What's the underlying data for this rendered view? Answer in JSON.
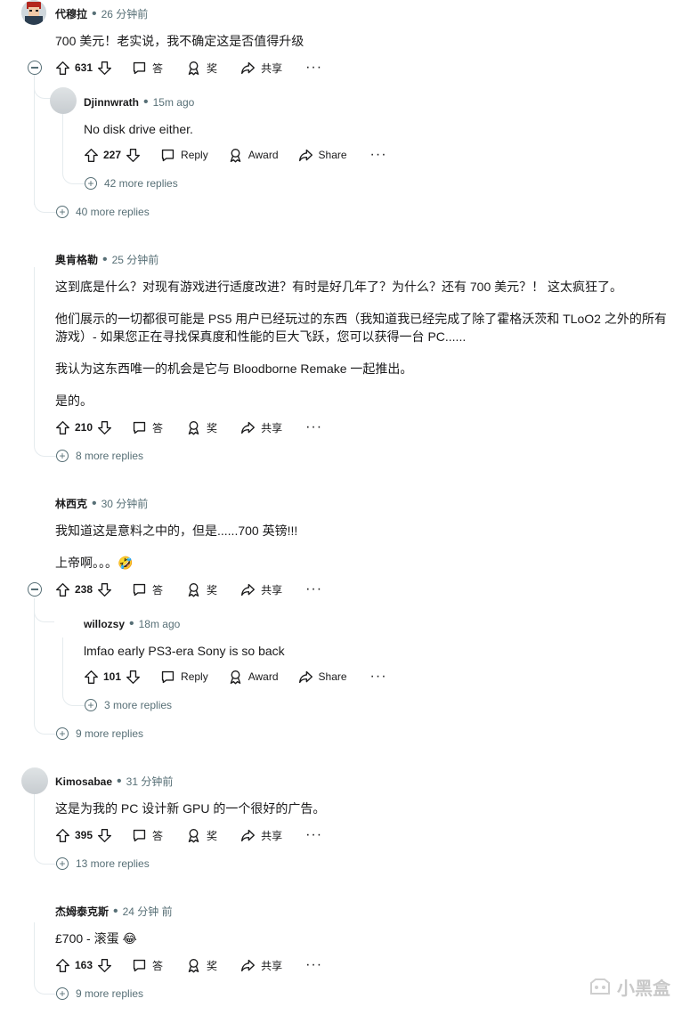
{
  "comments": [
    {
      "author": "代穆拉",
      "time": "26 分钟前",
      "body": [
        "700 美元！老实说，我不确定这是否值得升级"
      ],
      "votes": "631",
      "reply": "答",
      "award": "奖",
      "share": "共享",
      "reply_thread": {
        "author": "Djinnwrath",
        "time": "15m ago",
        "body": "No disk drive either.",
        "votes": "227",
        "reply": "Reply",
        "award": "Award",
        "share": "Share",
        "more": "42 more replies"
      },
      "more": "40 more replies"
    },
    {
      "author": "奥肯格勒",
      "time": "25 分钟前",
      "body": [
        "这到底是什么？对现有游戏进行适度改进？有时是好几年了？为什么？还有 700 美元？！ 这太疯狂了。",
        "他们展示的一切都很可能是 PS5 用户已经玩过的东西（我知道我已经完成了除了霍格沃茨和 TLoO2 之外的所有游戏）- 如果您正在寻找保真度和性能的巨大飞跃，您可以获得一台 PC......",
        "我认为这东西唯一的机会是它与 Bloodborne Remake 一起推出。",
        "是的。"
      ],
      "votes": "210",
      "reply": "答",
      "award": "奖",
      "share": "共享",
      "more": "8 more replies"
    },
    {
      "author": "林西克",
      "time": "30 分钟前",
      "body": [
        "我知道这是意料之中的，但是......700 英镑!!!",
        "上帝啊。。。🤣"
      ],
      "votes": "238",
      "reply": "答",
      "award": "奖",
      "share": "共享",
      "reply_thread": {
        "author": "willozsy",
        "time": "18m ago",
        "body": "lmfao early PS3-era Sony is so back",
        "votes": "101",
        "reply": "Reply",
        "award": "Award",
        "share": "Share",
        "more": "3 more replies"
      },
      "more": "9 more replies"
    },
    {
      "author": "Kimosabae",
      "time": "31 分钟前",
      "body": [
        "这是为我的 PC 设计新 GPU 的一个很好的广告。"
      ],
      "votes": "395",
      "reply": "答",
      "award": "奖",
      "share": "共享",
      "more": "13 more replies"
    },
    {
      "author": "杰姆泰克斯",
      "time": "24 分钟 前",
      "body": [
        "£700 - 滚蛋 😂"
      ],
      "votes": "163",
      "reply": "答",
      "award": "奖",
      "share": "共享",
      "more": "9 more replies"
    }
  ],
  "watermark": "小黑盒",
  "colors": {
    "text": "#1a1a1b",
    "meta": "#576f76",
    "thread_line": "#e5ebee"
  },
  "icons": [
    "upvote-icon",
    "downvote-icon",
    "comment-icon",
    "award-icon",
    "share-icon",
    "overflow-icon",
    "expand-icon",
    "collapse-icon"
  ]
}
